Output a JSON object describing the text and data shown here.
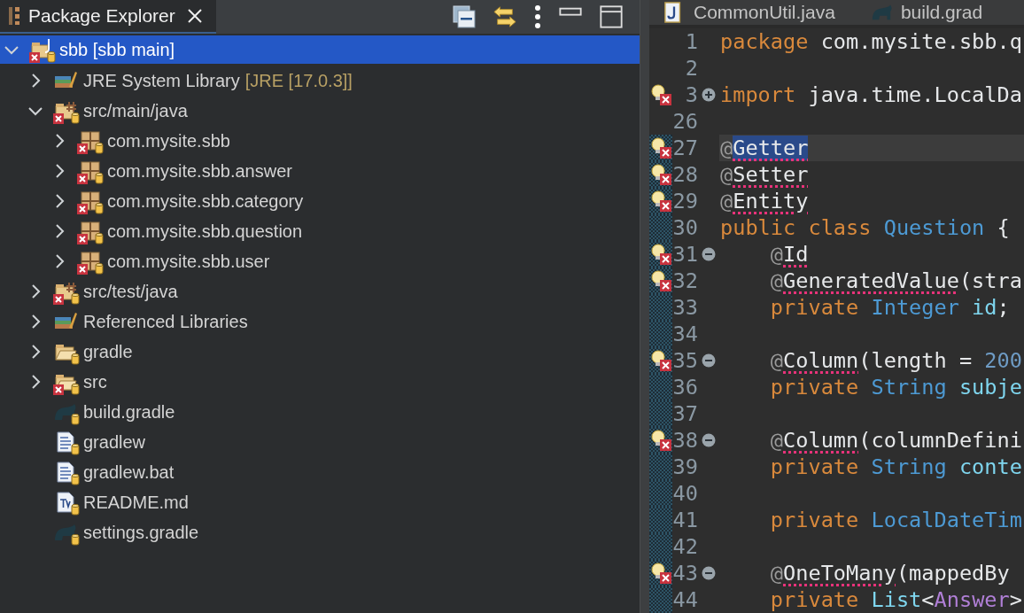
{
  "package_explorer": {
    "title": "Package Explorer",
    "tree": [
      {
        "label": "sbb [sbb main]",
        "kind": "project",
        "error": true,
        "versioned": true,
        "expanded": true,
        "selected": true,
        "children": [
          {
            "label": "JRE System Library",
            "decoration": "[JRE [17.0.3]]",
            "kind": "library",
            "error": false,
            "versioned": false,
            "expanded": false,
            "selected": false
          },
          {
            "label": "src/main/java",
            "kind": "source-folder",
            "error": true,
            "versioned": true,
            "expanded": true,
            "selected": false,
            "children": [
              {
                "label": "com.mysite.sbb",
                "kind": "package",
                "error": true,
                "versioned": true,
                "expanded": false,
                "selected": false
              },
              {
                "label": "com.mysite.sbb.answer",
                "kind": "package",
                "error": true,
                "versioned": true,
                "expanded": false,
                "selected": false
              },
              {
                "label": "com.mysite.sbb.category",
                "kind": "package",
                "error": true,
                "versioned": true,
                "expanded": false,
                "selected": false
              },
              {
                "label": "com.mysite.sbb.question",
                "kind": "package",
                "error": true,
                "versioned": true,
                "expanded": false,
                "selected": false
              },
              {
                "label": "com.mysite.sbb.user",
                "kind": "package",
                "error": true,
                "versioned": true,
                "expanded": false,
                "selected": false
              }
            ]
          },
          {
            "label": "src/test/java",
            "kind": "source-folder",
            "error": true,
            "versioned": true,
            "expanded": false,
            "selected": false
          },
          {
            "label": "Referenced Libraries",
            "kind": "library",
            "error": false,
            "versioned": false,
            "expanded": false,
            "selected": false
          },
          {
            "label": "gradle",
            "kind": "folder",
            "error": false,
            "versioned": true,
            "expanded": false,
            "selected": false
          },
          {
            "label": "src",
            "kind": "folder",
            "error": true,
            "versioned": true,
            "expanded": false,
            "selected": false
          },
          {
            "label": "build.gradle",
            "kind": "gradle-file",
            "error": false,
            "versioned": true,
            "selected": false
          },
          {
            "label": "gradlew",
            "kind": "text-file",
            "error": false,
            "versioned": true,
            "selected": false
          },
          {
            "label": "gradlew.bat",
            "kind": "text-file",
            "error": false,
            "versioned": true,
            "selected": false
          },
          {
            "label": "README.md",
            "kind": "markdown-file",
            "error": false,
            "versioned": true,
            "selected": false
          },
          {
            "label": "settings.gradle",
            "kind": "gradle-file",
            "error": false,
            "versioned": true,
            "selected": false
          }
        ]
      }
    ]
  },
  "editor": {
    "tabs": [
      {
        "label": "CommonUtil.java",
        "kind": "java",
        "selected": false
      },
      {
        "label": "build.grad",
        "kind": "gradle",
        "selected": false
      }
    ],
    "lines": [
      {
        "number": "1",
        "problem": false,
        "changed": false,
        "current": false,
        "tokens": [
          {
            "text": "package ",
            "kind": "keyword"
          },
          {
            "text": "com.mysite.sbb.q",
            "kind": "plain"
          }
        ]
      },
      {
        "number": "2",
        "problem": false,
        "changed": false,
        "current": false
      },
      {
        "number": "3",
        "problem": true,
        "collapsed": true,
        "changed": false,
        "current": false,
        "tokens": [
          {
            "text": "import ",
            "kind": "keyword"
          },
          {
            "text": "java.time.LocalDa",
            "kind": "plain"
          }
        ]
      },
      {
        "number": "26",
        "problem": false,
        "changed": false,
        "current": false
      },
      {
        "number": "27",
        "problem": true,
        "changed": true,
        "current": true,
        "tokens": [
          {
            "text": "@",
            "kind": "at"
          },
          {
            "text": "Getter",
            "kind": "annotation",
            "error": true,
            "selected": true
          }
        ]
      },
      {
        "number": "28",
        "problem": true,
        "changed": true,
        "current": false,
        "tokens": [
          {
            "text": "@",
            "kind": "at"
          },
          {
            "text": "Setter",
            "kind": "annotation",
            "error": true,
            "selected": false
          }
        ]
      },
      {
        "number": "29",
        "problem": true,
        "changed": true,
        "current": false,
        "tokens": [
          {
            "text": "@",
            "kind": "at"
          },
          {
            "text": "Entity",
            "kind": "annotation",
            "error": true,
            "selected": false
          }
        ]
      },
      {
        "number": "30",
        "problem": false,
        "changed": true,
        "current": false,
        "tokens": [
          {
            "text": "public class ",
            "kind": "keyword"
          },
          {
            "text": "Question",
            "kind": "type"
          },
          {
            "text": " {",
            "kind": "plain"
          }
        ]
      },
      {
        "number": "31",
        "problem": true,
        "collapsed": false,
        "changed": true,
        "current": false,
        "tokens": [
          {
            "text": "    @",
            "kind": "at"
          },
          {
            "text": "Id",
            "kind": "annotation",
            "error": true,
            "selected": false
          }
        ]
      },
      {
        "number": "32",
        "problem": true,
        "changed": true,
        "current": false,
        "tokens": [
          {
            "text": "    @",
            "kind": "at"
          },
          {
            "text": "GeneratedValue",
            "kind": "annotation",
            "error": true,
            "selected": false
          },
          {
            "text": "(stra",
            "kind": "plain"
          }
        ]
      },
      {
        "number": "33",
        "problem": false,
        "changed": true,
        "current": false,
        "tokens": [
          {
            "text": "    private ",
            "kind": "keyword"
          },
          {
            "text": "Integer ",
            "kind": "type"
          },
          {
            "text": "id",
            "kind": "field"
          },
          {
            "text": ";",
            "kind": "plain"
          }
        ]
      },
      {
        "number": "34",
        "problem": false,
        "changed": true,
        "current": false
      },
      {
        "number": "35",
        "problem": true,
        "collapsed": false,
        "changed": true,
        "current": false,
        "tokens": [
          {
            "text": "    @",
            "kind": "at"
          },
          {
            "text": "Column",
            "kind": "annotation",
            "error": true,
            "selected": false
          },
          {
            "text": "(length = ",
            "kind": "plain"
          },
          {
            "text": "200",
            "kind": "number"
          }
        ]
      },
      {
        "number": "36",
        "problem": false,
        "changed": true,
        "current": false,
        "tokens": [
          {
            "text": "    private ",
            "kind": "keyword"
          },
          {
            "text": "String ",
            "kind": "type"
          },
          {
            "text": "subje",
            "kind": "field"
          }
        ]
      },
      {
        "number": "37",
        "problem": false,
        "changed": true,
        "current": false
      },
      {
        "number": "38",
        "problem": true,
        "collapsed": false,
        "changed": true,
        "current": false,
        "tokens": [
          {
            "text": "    @",
            "kind": "at"
          },
          {
            "text": "Column",
            "kind": "annotation",
            "error": true,
            "selected": false
          },
          {
            "text": "(columnDefini",
            "kind": "plain"
          }
        ]
      },
      {
        "number": "39",
        "problem": false,
        "changed": true,
        "current": false,
        "tokens": [
          {
            "text": "    private ",
            "kind": "keyword"
          },
          {
            "text": "String ",
            "kind": "type"
          },
          {
            "text": "conte",
            "kind": "field"
          }
        ]
      },
      {
        "number": "40",
        "problem": false,
        "changed": true,
        "current": false
      },
      {
        "number": "41",
        "problem": false,
        "changed": true,
        "current": false,
        "tokens": [
          {
            "text": "    private ",
            "kind": "keyword"
          },
          {
            "text": "LocalDateTim",
            "kind": "type"
          }
        ]
      },
      {
        "number": "42",
        "problem": false,
        "changed": true,
        "current": false
      },
      {
        "number": "43",
        "problem": true,
        "collapsed": false,
        "changed": true,
        "current": false,
        "tokens": [
          {
            "text": "    @",
            "kind": "at"
          },
          {
            "text": "OneToMany",
            "kind": "annotation",
            "error": true,
            "selected": false
          },
          {
            "text": "(mappedBy",
            "kind": "plain"
          }
        ]
      },
      {
        "number": "44",
        "problem": false,
        "changed": true,
        "current": false,
        "tokens": [
          {
            "text": "    private ",
            "kind": "keyword"
          },
          {
            "text": "List",
            "kind": "field"
          },
          {
            "text": "<",
            "kind": "plain"
          },
          {
            "text": "Answer",
            "kind": "generic"
          },
          {
            "text": ">",
            "kind": "plain"
          }
        ]
      }
    ]
  }
}
